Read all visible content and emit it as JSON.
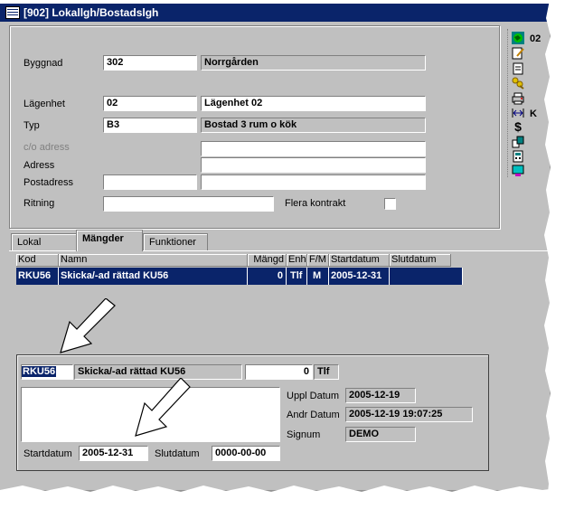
{
  "window": {
    "title": "[902] Lokallgh/Bostadslgh"
  },
  "form": {
    "byggnad": {
      "label": "Byggnad",
      "code": "302",
      "name": "Norrgården"
    },
    "lagenhet": {
      "label": "Lägenhet",
      "code": "02",
      "name": "Lägenhet 02"
    },
    "typ": {
      "label": "Typ",
      "code": "B3",
      "name": "Bostad 3 rum o kök"
    },
    "co_adress": {
      "label": "c/o adress",
      "value": ""
    },
    "adress": {
      "label": "Adress",
      "value": ""
    },
    "postadress": {
      "label": "Postadress",
      "zip": "",
      "city": ""
    },
    "ritning": {
      "label": "Ritning",
      "value": ""
    },
    "flera_kontrakt": {
      "label": "Flera kontrakt",
      "checked": false
    }
  },
  "sidebar": {
    "items": [
      {
        "icon": "world-icon",
        "label": "02"
      },
      {
        "icon": "edit-icon",
        "label": ""
      },
      {
        "icon": "document-icon",
        "label": ""
      },
      {
        "icon": "keys-icon",
        "label": ""
      },
      {
        "icon": "printer-icon",
        "label": ""
      },
      {
        "icon": "resize-icon",
        "label": "K"
      },
      {
        "icon": "dollar-icon",
        "label": ""
      },
      {
        "icon": "group-icon",
        "label": ""
      },
      {
        "icon": "calculator-icon",
        "label": ""
      },
      {
        "icon": "monitor-icon",
        "label": ""
      }
    ]
  },
  "tabs": [
    {
      "label": "Lokal"
    },
    {
      "label": "Mängder"
    },
    {
      "label": "Funktioner"
    }
  ],
  "grid": {
    "columns": [
      "Kod",
      "Namn",
      "Mängd",
      "Enh",
      "F/M",
      "Startdatum",
      "Slutdatum"
    ],
    "rows": [
      {
        "kod": "RKU56",
        "namn": "Skicka/-ad rättad KU56",
        "mangd": "0",
        "enh": "Tlf",
        "fm": "M",
        "startdatum": "2005-12-31",
        "slutdatum": ""
      }
    ]
  },
  "detail": {
    "kod": "RKU56",
    "namn": "Skicka/-ad rättad KU56",
    "mangd": "0",
    "enh": "Tlf",
    "notes": "",
    "uppl_datum": {
      "label": "Uppl Datum",
      "value": "2005-12-19"
    },
    "andr_datum": {
      "label": "Andr Datum",
      "value": "2005-12-19 19:07:25"
    },
    "signum": {
      "label": "Signum",
      "value": "DEMO"
    },
    "startdatum": {
      "label": "Startdatum",
      "value": "2005-12-31"
    },
    "slutdatum": {
      "label": "Slutdatum",
      "value": "0000-00-00"
    }
  },
  "colors": {
    "face": "#c0c0c0",
    "title": "#0a246a",
    "selection": "#0a246a"
  }
}
